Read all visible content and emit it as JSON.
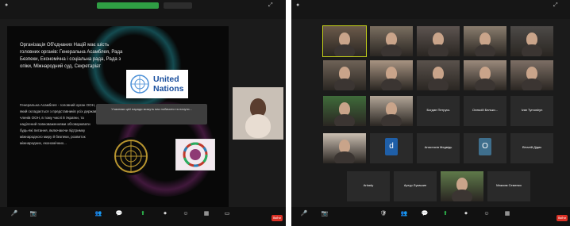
{
  "left": {
    "topbar": {
      "sharing_label": "",
      "view_label": ""
    },
    "slide": {
      "heading": "Організація Об'єднаних Націй має шість головних органів: Генеральна Асамблея, Рада Безпеки, Економічна і соціальна рада, Рада з опіки, Міжнародний суд, Секретаріат",
      "body": "Генеральна Асамблея - головний орган ООН, який складається з представників усіх держав-членів ООН, в тому числі й України, та наділений повноваженнями обговорювати будь-які питання, включаючи підтримку міжнародного миру й безпеки, розвиток міжнародних, економічних...",
      "logo_text_1": "United",
      "logo_text_2": "Nations",
      "popup_text": "Учасники цієї наради можуть вас побачити та почути..."
    },
    "self_view_name": "",
    "bottom_controls": [
      {
        "icon": "mic-icon",
        "glyph": "🎤",
        "label": ""
      },
      {
        "icon": "camera-icon",
        "glyph": "📷",
        "label": ""
      },
      {
        "icon": "participants-icon",
        "glyph": "👥",
        "label": ""
      },
      {
        "icon": "chat-icon",
        "glyph": "💬",
        "label": ""
      },
      {
        "icon": "share-icon",
        "glyph": "⬆",
        "label": ""
      },
      {
        "icon": "record-icon",
        "glyph": "⏺",
        "label": ""
      },
      {
        "icon": "reactions-icon",
        "glyph": "☺",
        "label": ""
      },
      {
        "icon": "apps-icon",
        "glyph": "▦",
        "label": ""
      },
      {
        "icon": "whiteboard-icon",
        "glyph": "▭",
        "label": ""
      }
    ],
    "end_label": "Вийти"
  },
  "right": {
    "tiles": [
      {
        "name": "",
        "center": "",
        "letter": "",
        "color": "#6b5a4a",
        "active": true
      },
      {
        "name": "",
        "center": "",
        "letter": "",
        "color": "#7a6e60"
      },
      {
        "name": "",
        "center": "",
        "letter": "",
        "color": "#5d5450"
      },
      {
        "name": "",
        "center": "",
        "letter": "",
        "color": "#8a7d6e"
      },
      {
        "name": "",
        "center": "",
        "letter": "",
        "color": "#4d4a48"
      },
      {
        "name": "",
        "center": "",
        "letter": "",
        "color": "#6f6357"
      },
      {
        "name": "",
        "center": "",
        "letter": "",
        "color": "#a89482"
      },
      {
        "name": "",
        "center": "",
        "letter": "",
        "color": "#5a524c"
      },
      {
        "name": "",
        "center": "",
        "letter": "",
        "color": "#9b8a7c"
      },
      {
        "name": "",
        "center": "",
        "letter": "",
        "color": "#7d6f65"
      },
      {
        "name": "",
        "center": "",
        "letter": "",
        "color": "#3f6b3a"
      },
      {
        "name": "",
        "center": "",
        "letter": "",
        "color": "#b2a597"
      },
      {
        "name": "",
        "center": "Богдан Петрусь",
        "letter": "",
        "color": "#222"
      },
      {
        "name": "",
        "center": "Олексій Белько...",
        "letter": "",
        "color": "#222"
      },
      {
        "name": "",
        "center": "Ivan Tymoshyn",
        "letter": "",
        "color": "#222"
      },
      {
        "name": "",
        "center": "",
        "letter": "",
        "color": "#cbbfb2"
      },
      {
        "name": "",
        "center": "",
        "letter": "d",
        "color": "#1f5fa8"
      },
      {
        "name": "",
        "center": "Анастасія Медвідь",
        "letter": "",
        "color": "#222"
      },
      {
        "name": "",
        "center": "",
        "letter": "O",
        "color": "#3f6f8d"
      },
      {
        "name": "",
        "center": "Віталій Дідик",
        "letter": "",
        "color": "#222"
      },
      {
        "name": "",
        "center": "Arkady",
        "letter": "",
        "color": "#222"
      },
      {
        "name": "",
        "center": "Артур Лукашин",
        "letter": "",
        "color": "#222"
      },
      {
        "name": "",
        "center": "",
        "letter": "",
        "color": "#5f7a4a"
      },
      {
        "name": "",
        "center": "Максим Семенко",
        "letter": "",
        "color": "#222"
      }
    ],
    "bottom_controls": [
      {
        "icon": "mic-icon",
        "glyph": "🎤",
        "label": ""
      },
      {
        "icon": "camera-icon",
        "glyph": "📷",
        "label": ""
      },
      {
        "icon": "security-icon",
        "glyph": "🛡",
        "label": ""
      },
      {
        "icon": "participants-icon",
        "glyph": "👥",
        "label": ""
      },
      {
        "icon": "chat-icon",
        "glyph": "💬",
        "label": ""
      },
      {
        "icon": "share-icon",
        "glyph": "⬆",
        "label": ""
      },
      {
        "icon": "record-icon",
        "glyph": "⏺",
        "label": ""
      },
      {
        "icon": "reactions-icon",
        "glyph": "☺",
        "label": ""
      },
      {
        "icon": "apps-icon",
        "glyph": "▦",
        "label": ""
      }
    ],
    "end_label": "Вийти"
  }
}
